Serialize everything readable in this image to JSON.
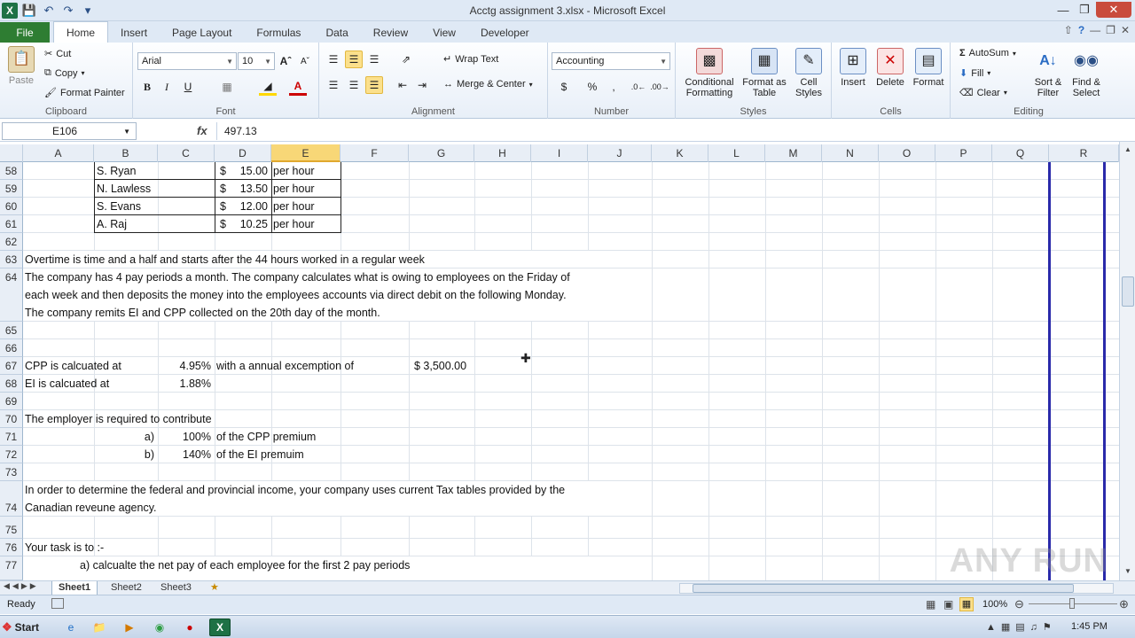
{
  "window": {
    "title": "Acctg assignment 3.xlsx - Microsoft Excel",
    "logo": "X"
  },
  "ribbon_tabs": [
    "File",
    "Home",
    "Insert",
    "Page Layout",
    "Formulas",
    "Data",
    "Review",
    "View",
    "Developer"
  ],
  "clipboard": {
    "paste": "Paste",
    "cut": "Cut",
    "copy": "Copy",
    "format_painter": "Format Painter",
    "label": "Clipboard"
  },
  "font": {
    "name": "Arial",
    "size": "10",
    "label": "Font"
  },
  "alignment": {
    "wrap": "Wrap Text",
    "merge": "Merge & Center",
    "label": "Alignment"
  },
  "number": {
    "format": "Accounting",
    "label": "Number",
    "dollar": "$",
    "percent": "%",
    "comma": ","
  },
  "styles": {
    "conditional": "Conditional Formatting",
    "format_table": "Format as Table",
    "cell_styles": "Cell Styles",
    "label": "Styles"
  },
  "cells": {
    "insert": "Insert",
    "delete": "Delete",
    "format": "Format",
    "label": "Cells"
  },
  "editing": {
    "autosum": "AutoSum",
    "fill": "Fill",
    "clear": "Clear",
    "sort": "Sort & Filter",
    "find": "Find & Select",
    "label": "Editing"
  },
  "formula_bar": {
    "name_box": "E106",
    "fx": "fx",
    "value": "497.13"
  },
  "columns": [
    "A",
    "B",
    "C",
    "D",
    "E",
    "F",
    "G",
    "H",
    "I",
    "J",
    "K",
    "L",
    "M",
    "N",
    "O",
    "P",
    "Q",
    "R"
  ],
  "rows": [
    "58",
    "59",
    "60",
    "61",
    "62",
    "63",
    "64",
    "65",
    "66",
    "67",
    "68",
    "69",
    "70",
    "71",
    "72",
    "73",
    "74",
    "75",
    "76",
    "77"
  ],
  "employees": [
    {
      "name": "S. Ryan",
      "dollar": "$",
      "rate": "15.00",
      "unit": "per hour"
    },
    {
      "name": "N. Lawless",
      "dollar": "$",
      "rate": "13.50",
      "unit": "per hour"
    },
    {
      "name": "S. Evans",
      "dollar": "$",
      "rate": "12.00",
      "unit": "per hour"
    },
    {
      "name": "A. Raj",
      "dollar": "$",
      "rate": "10.25",
      "unit": "per hour"
    }
  ],
  "text": {
    "r63": "Overtime is time and a half and starts after the 44 hours worked in a regular week",
    "r64a": "The company has 4 pay periods a month. The company calculates what is owing to employees on the Friday of",
    "r64b": "each week and then deposits the money into the employees accounts via direct debit on the following Monday.",
    "r64c": "The company remits EI and CPP collected on the 20th day of the month.",
    "r67a": "CPP is calcuated at",
    "r67c": "4.95%",
    "r67d": "with a annual excemption of",
    "r67g": "$ 3,500.00",
    "r68a": "EI is calcuated at",
    "r68c": "1.88%",
    "r70": "The employer is required to contribute",
    "r71b": "a)",
    "r71c": "100%",
    "r71d": "of the CPP premium",
    "r72b": "b)",
    "r72c": "140%",
    "r72d": "of the EI premuim",
    "r74a": "In order to determine the federal and provincial income, your company uses current Tax tables provided by the",
    "r74b": "Canadian reveune agency.",
    "r76": "Your task is to :-",
    "r77": "a)  calcualte the net pay of each employee for the first 2 pay periods"
  },
  "sheets": [
    "Sheet1",
    "Sheet2",
    "Sheet3"
  ],
  "status": {
    "ready": "Ready",
    "zoom": "100%"
  },
  "taskbar": {
    "start": "Start",
    "clock": "1:45 PM"
  },
  "watermark": "ANY RUN"
}
